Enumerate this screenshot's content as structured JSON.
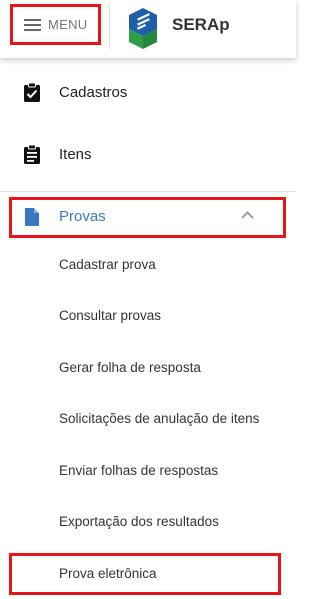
{
  "header": {
    "menu_label": "MENU",
    "brand": "SERAp"
  },
  "nav": {
    "items": [
      {
        "label": "Cadastros",
        "icon": "clipboard-check-icon"
      },
      {
        "label": "Itens",
        "icon": "clipboard-text-icon"
      },
      {
        "label": "Provas",
        "icon": "document-icon",
        "expanded": true
      }
    ],
    "provas_submenu": [
      "Cadastrar prova",
      "Consultar provas",
      "Gerar folha de resposta",
      "Solicitações de anulação de itens",
      "Enviar folhas de respostas",
      "Exportação dos resultados",
      "Prova eletrônica"
    ]
  },
  "colors": {
    "accent_blue": "#3a78c3",
    "highlight_red": "#e8141c",
    "logo_green": "#2e9e49",
    "logo_blue": "#1f5fa8"
  }
}
